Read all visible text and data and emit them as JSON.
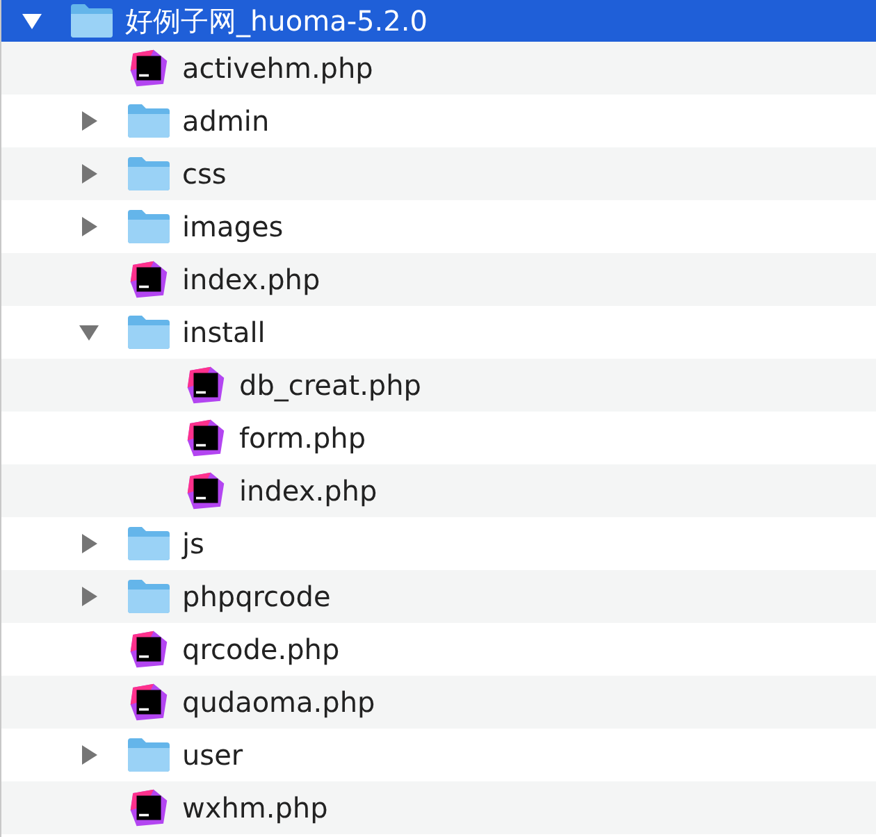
{
  "tree": [
    {
      "name": "好例子网_huoma-5.2.0",
      "kind": "folder",
      "expanded": true,
      "selected": true,
      "children": [
        {
          "name": "activehm.php",
          "kind": "php",
          "selected": false
        },
        {
          "name": "admin",
          "kind": "folder",
          "expanded": false,
          "selected": false
        },
        {
          "name": "css",
          "kind": "folder",
          "expanded": false,
          "selected": false
        },
        {
          "name": "images",
          "kind": "folder",
          "expanded": false,
          "selected": false
        },
        {
          "name": "index.php",
          "kind": "php",
          "selected": false
        },
        {
          "name": "install",
          "kind": "folder",
          "expanded": true,
          "selected": false,
          "children": [
            {
              "name": "db_creat.php",
              "kind": "php",
              "selected": false
            },
            {
              "name": "form.php",
              "kind": "php",
              "selected": false
            },
            {
              "name": "index.php",
              "kind": "php",
              "selected": false
            }
          ]
        },
        {
          "name": "js",
          "kind": "folder",
          "expanded": false,
          "selected": false
        },
        {
          "name": "phpqrcode",
          "kind": "folder",
          "expanded": false,
          "selected": false
        },
        {
          "name": "qrcode.php",
          "kind": "php",
          "selected": false
        },
        {
          "name": "qudaoma.php",
          "kind": "php",
          "selected": false
        },
        {
          "name": "user",
          "kind": "folder",
          "expanded": false,
          "selected": false
        },
        {
          "name": "wxhm.php",
          "kind": "php",
          "selected": false
        }
      ]
    }
  ]
}
